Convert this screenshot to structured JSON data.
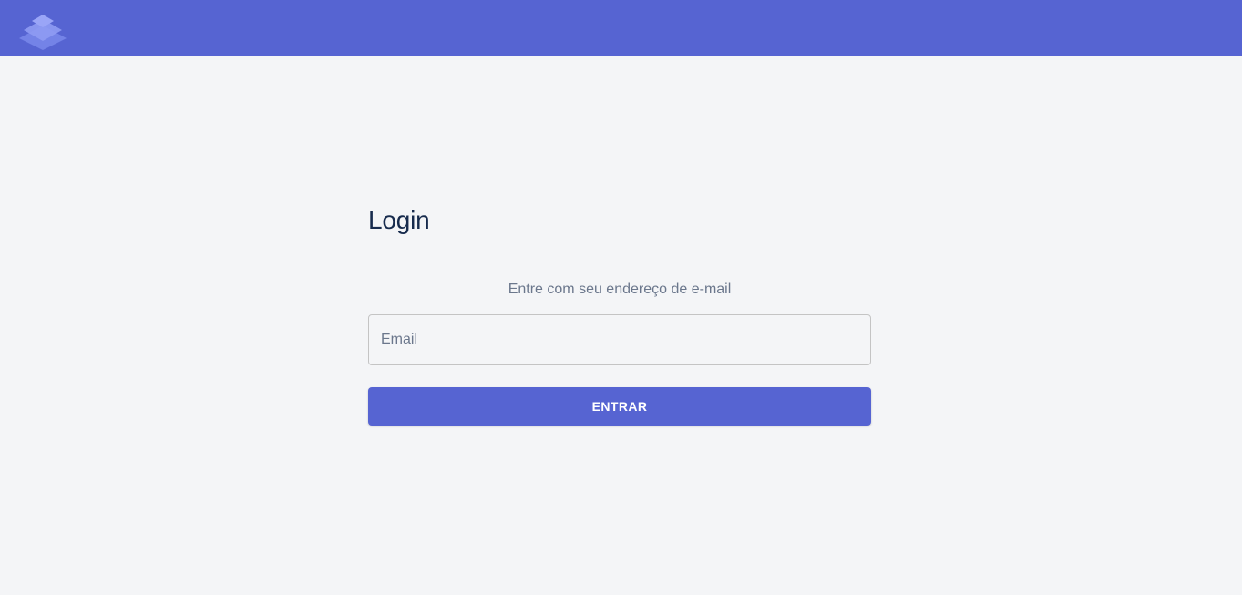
{
  "header": {
    "logo_icon": "stacked-layers-logo",
    "background_color": "#5664d2"
  },
  "login": {
    "title": "Login",
    "subtitle": "Entre com seu endereço de e-mail",
    "email_placeholder": "Email",
    "email_value": "",
    "submit_label": "ENTRAR",
    "accent_color": "#5664d2"
  }
}
